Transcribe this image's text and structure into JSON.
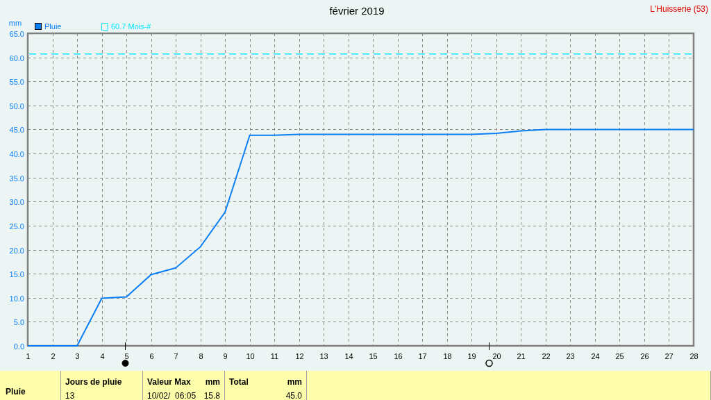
{
  "title": "février 2019",
  "station": "L'Huisserie (53)",
  "chart_data": {
    "type": "line",
    "grid": true,
    "legend": "top left",
    "ylabel": "mm",
    "x": [
      1,
      2,
      3,
      4,
      5,
      6,
      7,
      8,
      9,
      10,
      11,
      12,
      13,
      14,
      15,
      16,
      17,
      18,
      19,
      20,
      21,
      22,
      23,
      24,
      25,
      26,
      27,
      28
    ],
    "xlim": [
      1,
      28
    ],
    "ylim": [
      0,
      65
    ],
    "xticks": [
      1,
      2,
      3,
      4,
      5,
      6,
      7,
      8,
      9,
      10,
      11,
      12,
      13,
      14,
      15,
      16,
      17,
      18,
      19,
      20,
      21,
      22,
      23,
      24,
      25,
      26,
      27,
      28
    ],
    "yticks": [
      {
        "value": 0,
        "label": "0.0"
      },
      {
        "value": 5,
        "label": "5.0"
      },
      {
        "value": 10,
        "label": "10.0"
      },
      {
        "value": 15,
        "label": "15.0"
      },
      {
        "value": 20,
        "label": "20.0"
      },
      {
        "value": 25,
        "label": "25.0"
      },
      {
        "value": 30,
        "label": "30.0"
      },
      {
        "value": 35,
        "label": "35.0"
      },
      {
        "value": 40,
        "label": "40.0"
      },
      {
        "value": 45,
        "label": "45.0"
      },
      {
        "value": 50,
        "label": "50.0"
      },
      {
        "value": 55,
        "label": "55.0"
      },
      {
        "value": 60,
        "label": "60.0"
      },
      {
        "value": 65,
        "label": "65.0"
      }
    ],
    "series": [
      {
        "name": "Pluie",
        "color": "#0a7ff5",
        "values": [
          0,
          0,
          0,
          9.9,
          10.2,
          14.8,
          16.2,
          20.6,
          27.8,
          43.8,
          43.8,
          44.0,
          44.0,
          44.0,
          44.0,
          44.0,
          44.0,
          44.0,
          44.0,
          44.2,
          44.7,
          45.0,
          45.0,
          45.0,
          45.0,
          45.0,
          45.0,
          45.0
        ]
      }
    ],
    "ref_lines": [
      {
        "axis": "y",
        "value": 60.7,
        "label": "60.7 Mois-#",
        "color": "#00e5ff"
      }
    ]
  },
  "moon_markers": [
    {
      "kind": "new"
    },
    {
      "kind": "full"
    }
  ],
  "summary": {
    "row_label": "Pluie",
    "groups": [
      {
        "heading": "Jours de pluie",
        "values": [
          "13"
        ]
      },
      {
        "heading": "Valeur Max",
        "unit": "mm",
        "values": [
          "10/02/  06:05",
          "15.8"
        ]
      },
      {
        "heading": "Total",
        "unit": "mm",
        "values": [
          "45.0"
        ]
      }
    ]
  }
}
